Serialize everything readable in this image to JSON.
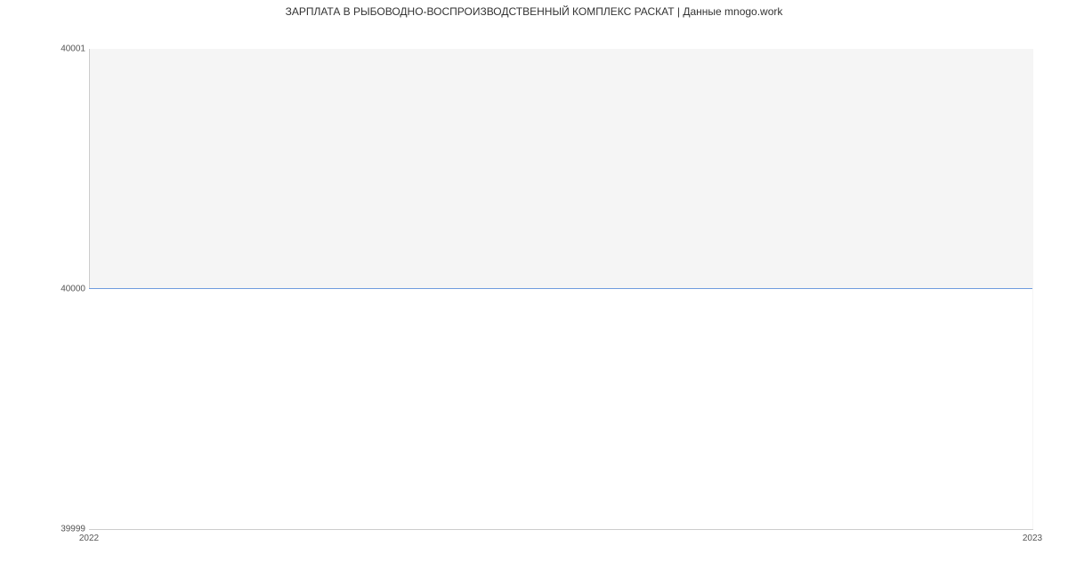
{
  "chart_data": {
    "type": "line",
    "title": "ЗАРПЛАТА В  РЫБОВОДНО-ВОСПРОИЗВОДСТВЕННЫЙ КОМПЛЕКС РАСКАТ | Данные mnogo.work",
    "xlabel": "",
    "ylabel": "",
    "x_ticks": [
      "2022",
      "2023"
    ],
    "y_ticks": [
      39999,
      40000,
      40001
    ],
    "ylim": [
      39999,
      40001
    ],
    "series": [
      {
        "name": "salary",
        "color": "#6f9cde",
        "x": [
          "2022",
          "2023"
        ],
        "values": [
          40000,
          40000
        ]
      }
    ]
  }
}
